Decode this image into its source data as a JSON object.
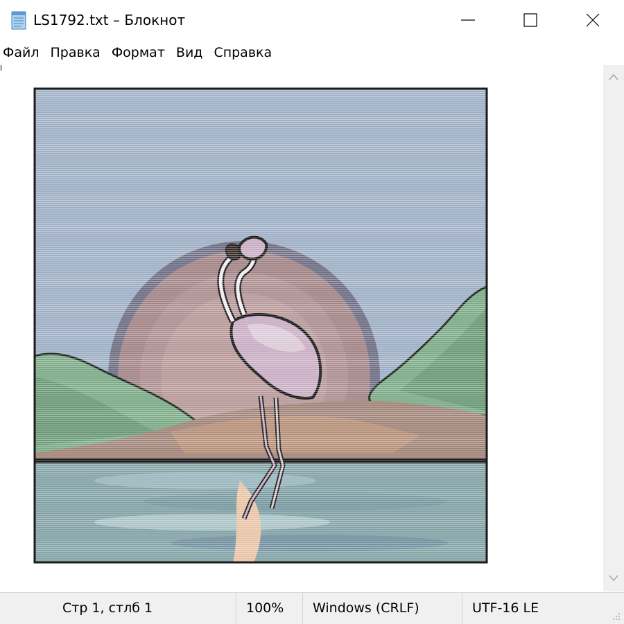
{
  "window": {
    "title": "LS1792.txt – Блокнот",
    "icon": "notepad-icon"
  },
  "menu": {
    "items": [
      "Файл",
      "Правка",
      "Формат",
      "Вид",
      "Справка"
    ]
  },
  "editor": {
    "content": "ASCII-art picture: flamingo standing in water before a setting sun with green hills"
  },
  "status": {
    "position": "Стр 1, стлб 1",
    "zoom": "100%",
    "line_endings": "Windows (CRLF)",
    "encoding": "UTF-16 LE"
  },
  "colors": {
    "sky": "#9fb0c6",
    "sun_ring": "#6f6f86",
    "sun": "#a8888c",
    "hills": "#7dab88",
    "water": "#84a3a6",
    "flamingo": "#c9aec4"
  }
}
